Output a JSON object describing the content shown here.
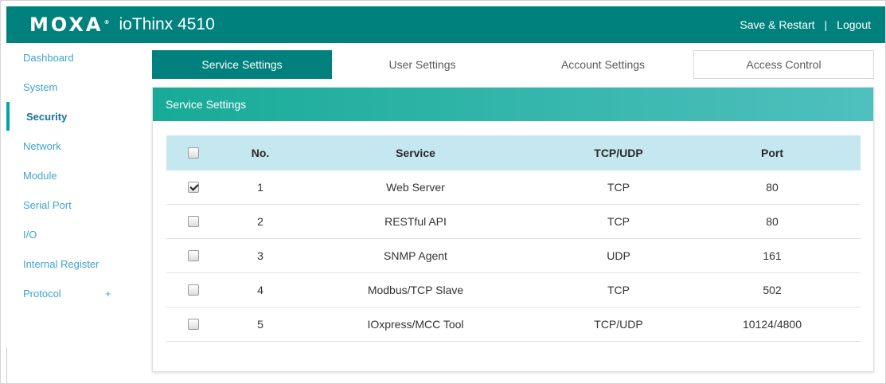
{
  "header": {
    "logo_text": "MOXA",
    "product": "ioThinx 4510",
    "save_restart": "Save & Restart",
    "separator": "|",
    "logout": "Logout",
    "color": "#00817e"
  },
  "sidebar": {
    "items": [
      {
        "label": "Dashboard"
      },
      {
        "label": "System"
      },
      {
        "label": "Security",
        "active": true
      },
      {
        "label": "Network"
      },
      {
        "label": "Module"
      },
      {
        "label": "Serial Port"
      },
      {
        "label": "I/O"
      },
      {
        "label": "Internal Register"
      },
      {
        "label": "Protocol",
        "expander": "+"
      }
    ]
  },
  "tabs": [
    {
      "label": "Service Settings",
      "active": true
    },
    {
      "label": "User Settings"
    },
    {
      "label": "Account Settings"
    },
    {
      "label": "Access Control"
    }
  ],
  "panel": {
    "title": "Service Settings",
    "table": {
      "headers": {
        "no": "No.",
        "service": "Service",
        "protocol": "TCP/UDP",
        "port": "Port"
      },
      "header_checked": false,
      "rows": [
        {
          "checked": true,
          "no": "1",
          "service": "Web Server",
          "protocol": "TCP",
          "port": "80"
        },
        {
          "checked": false,
          "no": "2",
          "service": "RESTful API",
          "protocol": "TCP",
          "port": "80"
        },
        {
          "checked": false,
          "no": "3",
          "service": "SNMP Agent",
          "protocol": "UDP",
          "port": "161"
        },
        {
          "checked": false,
          "no": "4",
          "service": "Modbus/TCP Slave",
          "protocol": "TCP",
          "port": "502"
        },
        {
          "checked": false,
          "no": "5",
          "service": "IOxpress/MCC Tool",
          "protocol": "TCP/UDP",
          "port": "10124/4800"
        }
      ]
    }
  }
}
